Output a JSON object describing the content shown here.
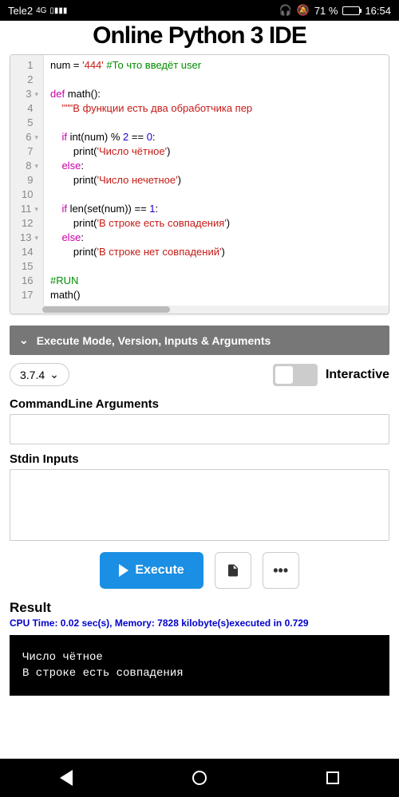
{
  "status": {
    "carrier": "Tele2",
    "net": "4G",
    "battery_pct": "71 %",
    "time": "16:54"
  },
  "page_title": "Online Python 3 IDE",
  "code": {
    "lines": [
      {
        "n": "1",
        "fold": "",
        "html": "num = <span class='tok-str'>'444'</span> <span class='tok-com'>#То что введёт user</span>"
      },
      {
        "n": "2",
        "fold": "",
        "html": ""
      },
      {
        "n": "3",
        "fold": "▾",
        "html": "<span class='tok-kw'>def</span> <span class='tok-fn'>math</span>():"
      },
      {
        "n": "4",
        "fold": "",
        "html": "    <span class='tok-str'>\"\"\"В функции есть два обработчика пер</span>"
      },
      {
        "n": "5",
        "fold": "",
        "html": ""
      },
      {
        "n": "6",
        "fold": "▾",
        "html": "    <span class='tok-kw'>if</span> int(num) % <span class='tok-num'>2</span> == <span class='tok-num'>0</span>:"
      },
      {
        "n": "7",
        "fold": "",
        "html": "        print(<span class='tok-str'>'Число чётное'</span>)"
      },
      {
        "n": "8",
        "fold": "▾",
        "html": "    <span class='tok-kw'>else</span>:"
      },
      {
        "n": "9",
        "fold": "",
        "html": "        print(<span class='tok-str'>'Число нечетное'</span>)"
      },
      {
        "n": "10",
        "fold": "",
        "html": ""
      },
      {
        "n": "11",
        "fold": "▾",
        "html": "    <span class='tok-kw'>if</span> len(set(num)) == <span class='tok-num'>1</span>:"
      },
      {
        "n": "12",
        "fold": "",
        "html": "        print(<span class='tok-str'>'В строке есть совпадения'</span>)"
      },
      {
        "n": "13",
        "fold": "▾",
        "html": "    <span class='tok-kw'>else</span>:"
      },
      {
        "n": "14",
        "fold": "",
        "html": "        print(<span class='tok-str'>'В строке нет совпадений'</span>)"
      },
      {
        "n": "15",
        "fold": "",
        "html": ""
      },
      {
        "n": "16",
        "fold": "",
        "html": "<span class='tok-com'>#RUN</span>"
      },
      {
        "n": "17",
        "fold": "",
        "html": "math()"
      }
    ]
  },
  "section_header": "Execute Mode, Version, Inputs & Arguments",
  "version": "3.7.4",
  "interactive_label": "Interactive",
  "cmdline_label": "CommandLine Arguments",
  "stdin_label": "Stdin Inputs",
  "execute_label": "Execute",
  "more_label": "•••",
  "result_label": "Result",
  "metrics": "CPU Time: 0.02 sec(s), Memory: 7828 kilobyte(s)executed in 0.729",
  "console_output": "Число чётное\nВ строке есть совпадения"
}
